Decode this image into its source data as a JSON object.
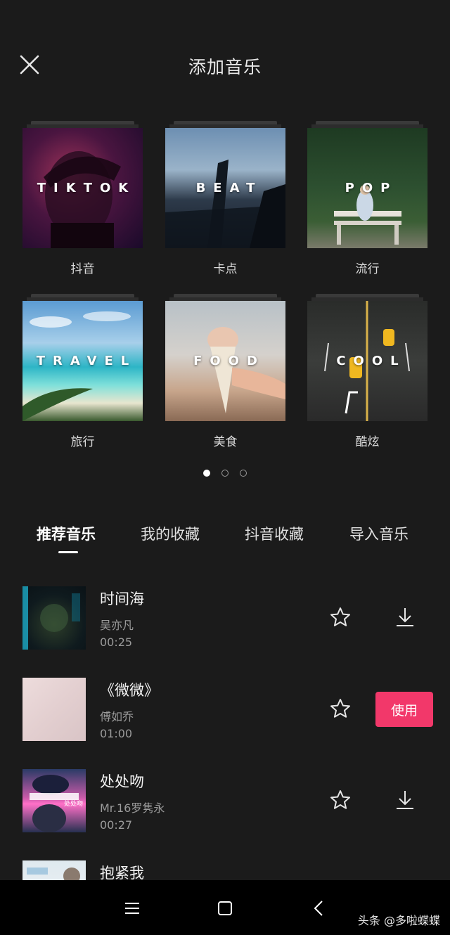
{
  "header": {
    "title": "添加音乐",
    "close_icon": "close-icon"
  },
  "categories": [
    {
      "cover_text": "TIKTOK",
      "label": "抖音"
    },
    {
      "cover_text": "BEAT",
      "label": "卡点"
    },
    {
      "cover_text": "POP",
      "label": "流行"
    },
    {
      "cover_text": "TRAVEL",
      "label": "旅行"
    },
    {
      "cover_text": "FOOD",
      "label": "美食"
    },
    {
      "cover_text": "COOL",
      "label": "酷炫"
    }
  ],
  "pager": {
    "total": 3,
    "active": 1
  },
  "tabs": [
    {
      "label": "推荐音乐",
      "active": true
    },
    {
      "label": "我的收藏",
      "active": false
    },
    {
      "label": "抖音收藏",
      "active": false
    },
    {
      "label": "导入音乐",
      "active": false
    }
  ],
  "songs": [
    {
      "title": "时间海",
      "artist": "吴亦凡",
      "duration": "00:25",
      "action": "download"
    },
    {
      "title": "《微微》",
      "artist": "傅如乔",
      "duration": "01:00",
      "action": "use",
      "use_label": "使用"
    },
    {
      "title": "处处吻",
      "artist": "Mr.16罗隽永",
      "duration": "00:27",
      "action": "download"
    },
    {
      "title": "抱紧我",
      "artist": "",
      "duration": "",
      "action": ""
    }
  ],
  "thumbnails": {
    "song3_text": "处处吻"
  },
  "navbar": {
    "watermark": "头条 @多啦蝶蝶"
  },
  "colors": {
    "background": "#1b1b1b",
    "accent": "#f2386a"
  }
}
